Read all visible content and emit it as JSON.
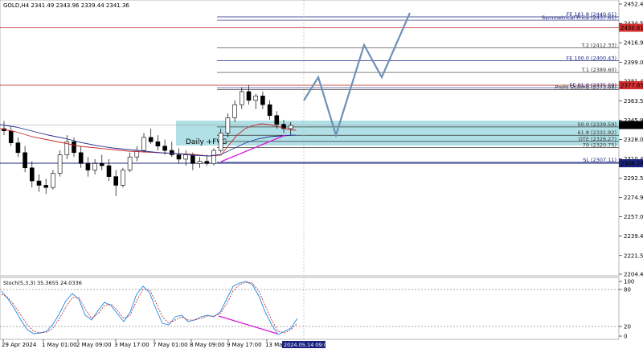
{
  "symbol_header": "GOLD,H4  2341.49 2343.96 2339.44 2341.36",
  "price_axis": [
    "2452.40",
    "2434.55",
    "2416.90",
    "2399.05",
    "2381.40",
    "2363.55",
    "2345.90",
    "2328.05",
    "2310.40",
    "2292.55",
    "2274.90",
    "2257.05",
    "2239.40",
    "2221.55",
    "2204.40"
  ],
  "fib_levels": [
    {
      "label": "FE 161.8 (2440.61)",
      "price": 2440.61,
      "color": "#1a237e"
    },
    {
      "label": "Symmetrical Price (2437.61)",
      "price": 2437.61,
      "color": "#1a237e"
    },
    {
      "label": "T.2 (2412.33)",
      "price": 2412.33,
      "color": "#333333"
    },
    {
      "label": "FE 100.0 (2400.43)",
      "price": 2400.43,
      "color": "#1a237e"
    },
    {
      "label": "T.1 (2389.60)",
      "price": 2389.6,
      "color": "#333333"
    },
    {
      "label": "FE 61.8 (2375.59)",
      "price": 2375.59,
      "color": "#1a237e"
    },
    {
      "label": "Profit Scaling (2373.68)",
      "price": 2373.68,
      "color": "#333333"
    },
    {
      "label": "50.0 (2339.59)",
      "price": 2339.59,
      "color": "#333333"
    },
    {
      "label": "61.8 (2331.92)",
      "price": 2331.92,
      "color": "#333333"
    },
    {
      "label": "OTE (2326.27)",
      "price": 2326.27,
      "color": "#333333"
    },
    {
      "label": "79 (2320.75)",
      "price": 2320.75,
      "color": "#333333"
    },
    {
      "label": "SL (2307.11)",
      "price": 2307.11,
      "color": "#1a237e"
    }
  ],
  "price_tags": [
    {
      "text": "2430.61",
      "price": 2430.61,
      "bg": "#d32f2f",
      "fg": "#ffffff"
    },
    {
      "text": "2377.85",
      "price": 2377.85,
      "bg": "#d32f2f",
      "fg": "#ffffff"
    },
    {
      "text": "2341.36",
      "price": 2341.36,
      "bg": "#000000",
      "fg": "#ffffff"
    },
    {
      "text": "2306.24",
      "price": 2306.24,
      "bg": "#1a237e",
      "fg": "#ffffff"
    }
  ],
  "fvg_label": "Daily +FVG",
  "stoch_header": "Stoch(5,3,3) 35.3655 24.0336",
  "stoch_axis": [
    "100",
    "80",
    "20",
    "0"
  ],
  "time_axis": [
    "29 Apr 2024",
    "1 May 01:00",
    "2 May 09:00",
    "3 May 17:00",
    "7 May 01:00",
    "8 May 09:00",
    "9 May 17:00",
    "13 Ma"
  ],
  "time_highlight": "2024.05.14 09:00",
  "colors": {
    "fvg": "#a7dde3",
    "red_line": "#b71c1c",
    "navy_line": "#1a237e",
    "ma_red": "#c62828",
    "ma_blue": "#283593",
    "divergence": "#d81bd8",
    "projection": "#7090b8",
    "stoch_main": "#1e88e5",
    "stoch_signal": "#b71c1c"
  }
}
